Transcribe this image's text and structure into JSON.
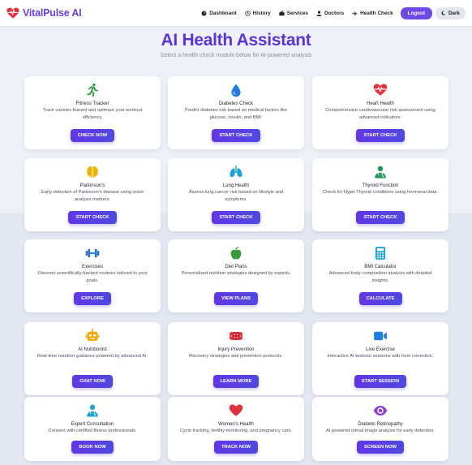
{
  "brand": {
    "name": "VitalPulse AI"
  },
  "nav": {
    "items": [
      {
        "label": "Dashboard",
        "icon": "gauge-icon"
      },
      {
        "label": "History",
        "icon": "history-icon"
      },
      {
        "label": "Services",
        "icon": "briefcase-icon"
      },
      {
        "label": "Doctors",
        "icon": "doctor-icon"
      },
      {
        "label": "Health Check",
        "icon": "heartbeat-icon"
      }
    ],
    "logout": "Logout",
    "dark": "Dark"
  },
  "hero": {
    "title": "AI Health Assistant",
    "subtitle": "Select a health check module below for AI-powered analysis"
  },
  "cards": [
    {
      "title": "Fitness Tracker",
      "desc": "Track calories burned and optimize your workout efficiency.",
      "button": "CHECK NOW",
      "icon": "running-icon",
      "color": "#2e9b4a"
    },
    {
      "title": "Diabetes Check",
      "desc": "Predict diabetes risk based on medical factors like glucose, insulin, and BMI.",
      "button": "START CHECK",
      "icon": "droplet-icon",
      "color": "#1f7fe0"
    },
    {
      "title": "Heart Health",
      "desc": "Comprehensive cardiovascular risk assessment using advanced indicators.",
      "button": "START CHECK",
      "icon": "heartbeat-icon",
      "color": "#e0323f"
    },
    {
      "title": "Parkinson's",
      "desc": "Early detection of Parkinson's disease using voice analysis markers.",
      "button": "START CHECK",
      "icon": "brain-icon",
      "color": "#f2b705"
    },
    {
      "title": "Lung Health",
      "desc": "Assess lung cancer risk based on lifestyle and symptoms.",
      "button": "START CHECK",
      "icon": "lungs-icon",
      "color": "#1aa3d6"
    },
    {
      "title": "Thyroid Function",
      "desc": "Check for Hypo-Thyroid conditions using hormonal data.",
      "button": "START CHECK",
      "icon": "doctor-icon",
      "color": "#23975a"
    },
    {
      "title": "Exercises",
      "desc": "Discover scientifically-backed routines tailored to your goals.",
      "button": "EXPLORE",
      "icon": "dumbbell-icon",
      "color": "#1f6fe0"
    },
    {
      "title": "Diet Plans",
      "desc": "Personalized nutrition strategies designed by experts.",
      "button": "VIEW PLANS",
      "icon": "apple-icon",
      "color": "#3a9b3c"
    },
    {
      "title": "BMI Calculator",
      "desc": "Advanced body composition analysis with detailed insights.",
      "button": "CALCULATE",
      "icon": "calculator-icon",
      "color": "#1aa3d6"
    },
    {
      "title": "AI Nutritionist",
      "desc": "Real-time nutrition guidance powered by advanced AI.",
      "button": "CHAT NOW",
      "icon": "robot-icon",
      "color": "#f2a705"
    },
    {
      "title": "Injury Prevention",
      "desc": "Recovery strategies and prevention protocols.",
      "button": "LEARN MORE",
      "icon": "bandage-icon",
      "color": "#e0323f"
    },
    {
      "title": "Live Exercise",
      "desc": "Interactive AI workout sessions with form correction.",
      "button": "START SESSION",
      "icon": "video-icon",
      "color": "#1f7fe0"
    },
    {
      "title": "Expert Consultation",
      "desc": "Connect with certified fitness professionals.",
      "button": "BOOK NOW",
      "icon": "doctor-icon",
      "color": "#1aa3d6"
    },
    {
      "title": "Women's Health",
      "desc": "Cycle tracking, fertility monitoring, and pregnancy care.",
      "button": "TRACK NOW",
      "icon": "heart-icon",
      "color": "#e0323f"
    },
    {
      "title": "Diabetic Retinopathy",
      "desc": "AI-powered retinal image analysis for early detection.",
      "button": "SCREEN NOW",
      "icon": "eye-icon",
      "color": "#8a3fd6"
    }
  ]
}
